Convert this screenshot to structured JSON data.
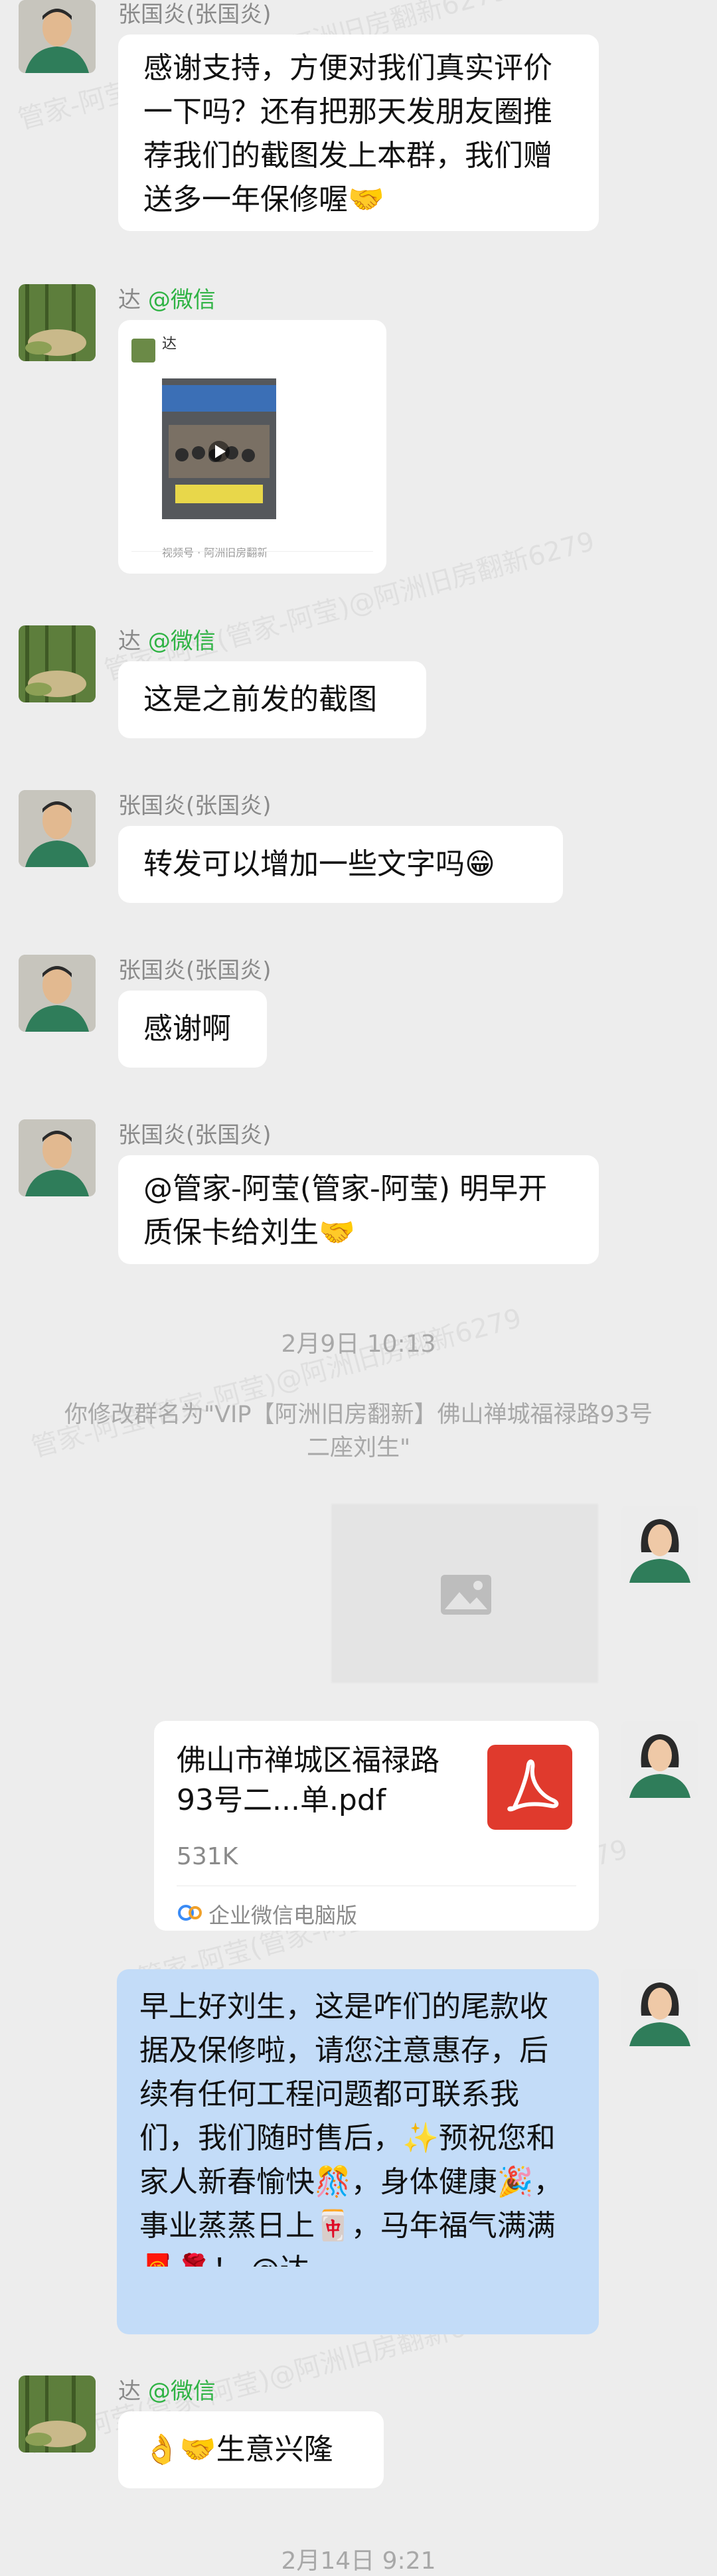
{
  "watermark": "管家-阿莹(管家-阿莹)@阿洲旧房翻新6279",
  "senders": {
    "zhang": "张国炎(张国炎)",
    "da_name": "达",
    "da_suffix": "@微信"
  },
  "messages": {
    "m1": "感谢支持，方便对我们真实评价一下吗？还有把那天发朋友圈推荐我们的截图发上本群，我们赠送多一年保修喔🤝",
    "m3": "这是之前发的截图",
    "m4": "转发可以增加一些文字吗😁",
    "m5": "感谢啊",
    "m6": "@管家-阿莹(管家-阿莹) 明早开质保卡给刘生🤝",
    "m9": "早上好刘生，这是咋们的尾款收据及保修啦，请您注意惠存，后续有任何工程问题都可联系我们，我们随时售后，✨预祝您和家人新春愉快🎊，身体健康🎉，事业蒸蒸日上🀄，马年福气满满🧧🌹！ @达",
    "m10": "👌🤝生意兴隆"
  },
  "shared_card": {
    "sender_initial": "达",
    "caption": "视频号 · 阿洲旧房翻新"
  },
  "timestamp1": "2月9日  10:13",
  "system_rename": "你修改群名为\"VIP【阿洲旧房翻新】佛山禅城福禄路93号二座刘生\"",
  "file": {
    "name": "佛山市禅城区福禄路93号二...单.pdf",
    "size": "531K",
    "source": "企业微信电脑版",
    "icon": "pdf-icon"
  },
  "timestamp2": "2月14日  9:21"
}
